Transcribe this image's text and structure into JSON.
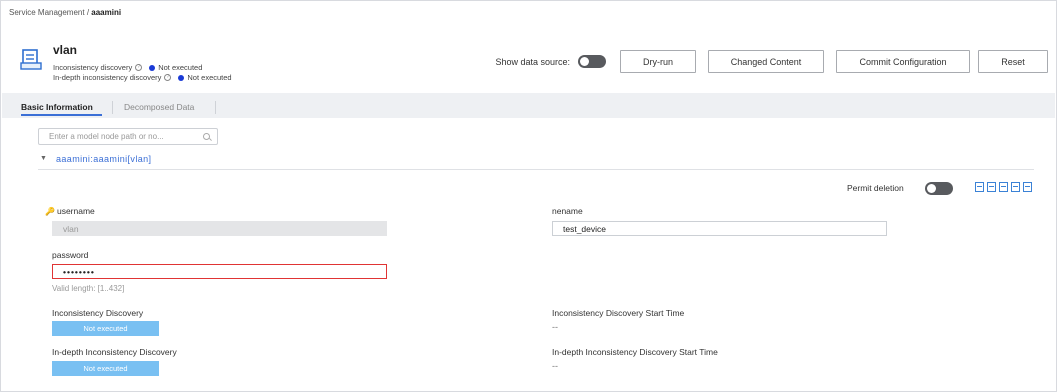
{
  "breadcrumb": {
    "parent": "Service Management",
    "separator": " / ",
    "current": "aaamini"
  },
  "service": {
    "icon": "service-document-icon",
    "title": "vlan",
    "inconsistency": {
      "label": "Inconsistency discovery",
      "status": "Not executed"
    },
    "indepth": {
      "label": "In-depth inconsistency discovery",
      "status": "Not executed"
    },
    "status_color": "#1a3ad6"
  },
  "toolbar": {
    "show_data_source_label": "Show data source:",
    "dry_run_label": "Dry-run",
    "changed_content_label": "Changed Content",
    "commit_label": "Commit Configuration",
    "reset_label": "Reset"
  },
  "tabs": [
    {
      "label": "Basic Information",
      "active": true
    },
    {
      "label": "Decomposed Data",
      "active": false
    }
  ],
  "search": {
    "placeholder": "Enter a model node path or no..."
  },
  "tree": {
    "node_label": "aaamini:aaamini[vlan]"
  },
  "permit_deletion": {
    "label": "Permit deletion",
    "enabled": false
  },
  "action_icons": [
    "copy-icon",
    "paste-icon",
    "export-icon",
    "import-icon",
    "clipboard-icon"
  ],
  "form": {
    "username": {
      "label": "username",
      "value": "vlan",
      "key_icon": "key-icon"
    },
    "password": {
      "label": "password",
      "value": "••••••••",
      "hint": "Valid length: [1..432]"
    },
    "neName": {
      "label": "nename",
      "value": "test_device"
    },
    "inconsistency_discovery": {
      "label": "Inconsistency Discovery",
      "value": "Not executed"
    },
    "inconsistency_start": {
      "label": "Inconsistency Discovery Start Time",
      "value": "--"
    },
    "indepth_discovery": {
      "label": "In-depth Inconsistency Discovery",
      "value": "Not executed"
    },
    "indepth_start": {
      "label": "In-depth Inconsistency Discovery Start Time",
      "value": "--"
    }
  },
  "colors": {
    "accent": "#3b6fd6",
    "badge": "#79c0f2",
    "error_border": "#e03434",
    "toggle_off": "#585a5e"
  }
}
